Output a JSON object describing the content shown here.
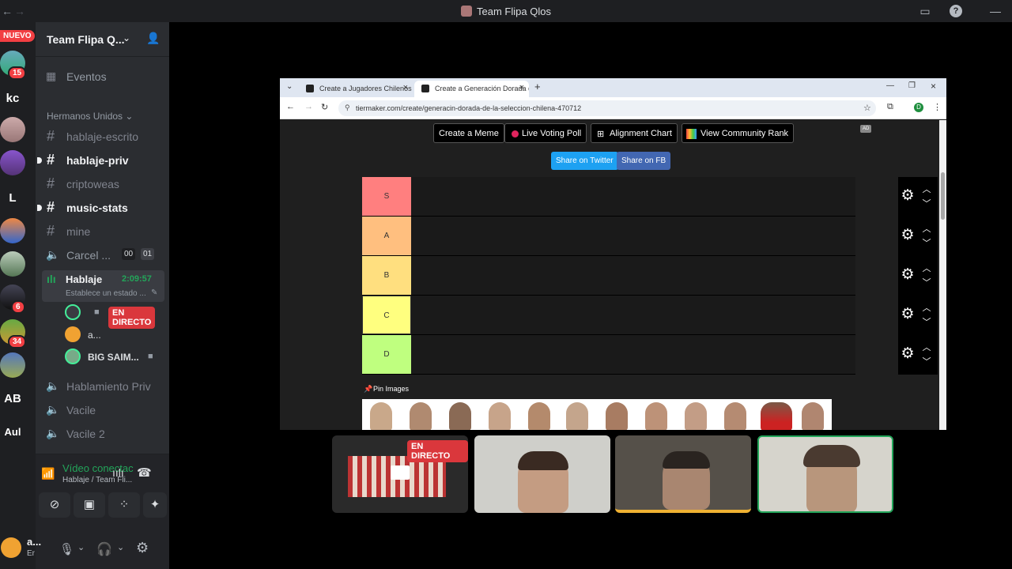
{
  "window": {
    "title": "Team Flipa Qlos"
  },
  "rail": {
    "new_badge": "NUEVO",
    "servers": [
      {
        "label": "",
        "badge": "15"
      },
      {
        "label": "kc",
        "badge": ""
      },
      {
        "label": "",
        "badge": ""
      },
      {
        "label": "",
        "badge": ""
      },
      {
        "label": "L",
        "badge": ""
      },
      {
        "label": "",
        "badge": ""
      },
      {
        "label": "",
        "badge": ""
      },
      {
        "label": "",
        "badge": "6"
      },
      {
        "label": "",
        "badge": "34"
      },
      {
        "label": "",
        "badge": ""
      },
      {
        "label": "AB",
        "badge": ""
      },
      {
        "label": "Aul",
        "badge": ""
      }
    ]
  },
  "sidebar": {
    "guild_name": "Team Flipa Q...",
    "eventos": "Eventos",
    "category": "Hermanos Unidos",
    "channels": {
      "hablaje_escrito": "hablaje-escrito",
      "hablaje_priv": "hablaje-priv",
      "criptoweas": "criptoweas",
      "music_stats": "music-stats",
      "mine": "mine",
      "carcel": "Carcel ...",
      "carcel_counts": [
        "00",
        "01"
      ],
      "hablaje": "Hablaje",
      "hablaje_time": "2:09:57",
      "hablaje_status": "Establece un estado ...",
      "hablamiento_priv": "Hablamiento Priv",
      "vacile": "Vacile",
      "vacile2": "Vacile 2"
    },
    "voice_users": [
      {
        "name": "",
        "live": "EN DIRECTO"
      },
      {
        "name": "a...",
        "live": ""
      },
      {
        "name": "BIG SAIM...",
        "live": ""
      }
    ],
    "voice_panel": {
      "status": "Vídeo conectac",
      "location": "Hablaje / Team Fli..."
    },
    "user_panel": {
      "name": "a...",
      "status": "Er"
    }
  },
  "browser": {
    "tabs": [
      {
        "label": "Create a Jugadores Chilenos / ..."
      },
      {
        "label": "Create a Generación Dorada de..."
      }
    ],
    "url": "tiermaker.com/create/generacin-dorada-de-la-seleccion-chilena-470712",
    "profile_initial": "D",
    "buttons": {
      "meme": "Create a Meme",
      "poll": "Live Voting Poll",
      "alignment": "Alignment Chart",
      "community": "View Community Rank",
      "twitter": "Share on Twitter",
      "fb": "Share on FB",
      "ad": "AD"
    },
    "tiers": [
      {
        "label": "S",
        "color": "#ff7f7f"
      },
      {
        "label": "A",
        "color": "#ffbf7f"
      },
      {
        "label": "B",
        "color": "#ffdf7f"
      },
      {
        "label": "C",
        "color": "#ffff7f"
      },
      {
        "label": "D",
        "color": "#bfff7f"
      }
    ],
    "pin_images": "Pin Images"
  },
  "video": {
    "live_tag": "EN DIRECTO"
  }
}
